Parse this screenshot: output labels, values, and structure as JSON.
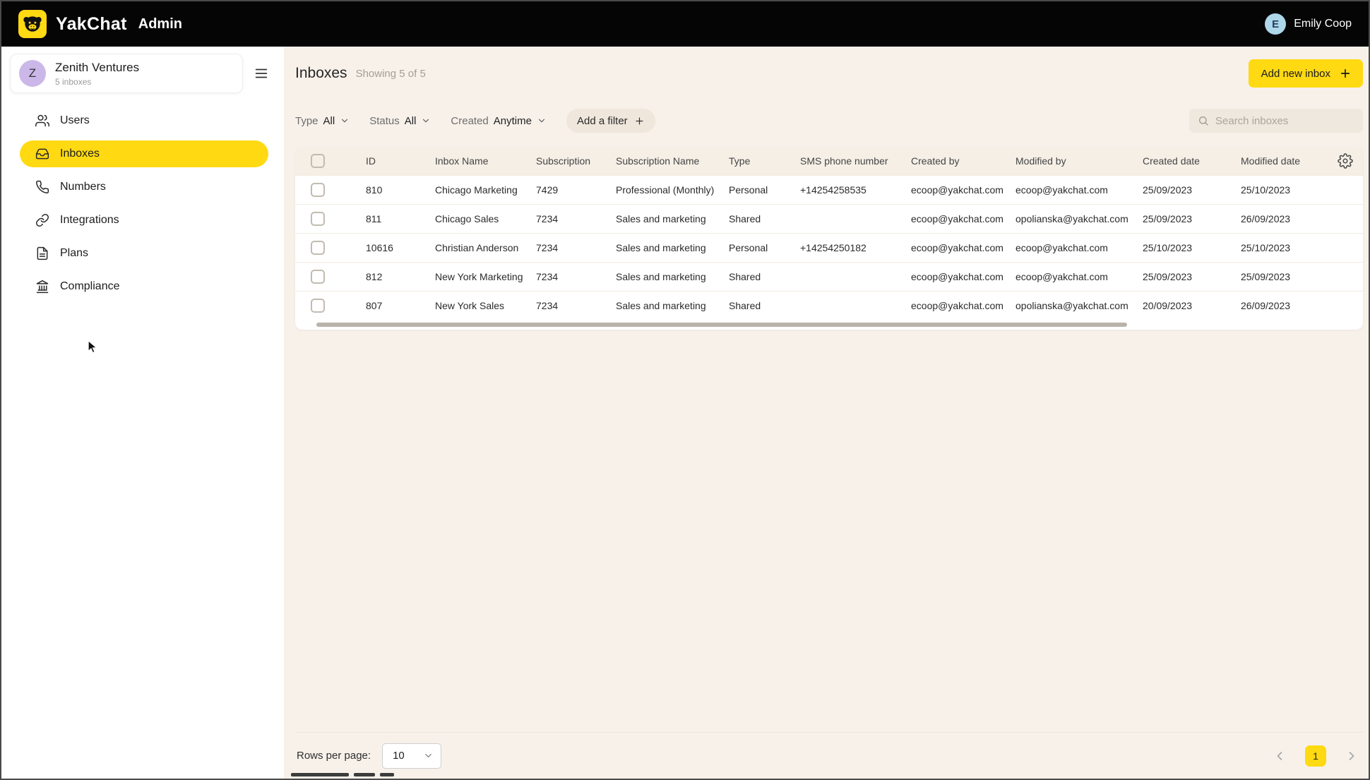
{
  "topbar": {
    "brand": "YakChat",
    "section": "Admin",
    "user": {
      "initial": "E",
      "name": "Emily Coop"
    }
  },
  "sidebar": {
    "org": {
      "initial": "Z",
      "name": "Zenith Ventures",
      "subtitle": "5 inboxes"
    },
    "items": [
      {
        "label": "Users",
        "icon": "users-icon",
        "active": false
      },
      {
        "label": "Inboxes",
        "icon": "inbox-icon",
        "active": true
      },
      {
        "label": "Numbers",
        "icon": "phone-icon",
        "active": false
      },
      {
        "label": "Integrations",
        "icon": "integrations-icon",
        "active": false
      },
      {
        "label": "Plans",
        "icon": "plans-icon",
        "active": false
      },
      {
        "label": "Compliance",
        "icon": "compliance-icon",
        "active": false
      }
    ]
  },
  "page": {
    "title": "Inboxes",
    "subtitle": "Showing 5 of 5",
    "add_button": "Add new inbox"
  },
  "filters": {
    "dropdowns": [
      {
        "label": "Type",
        "value": "All"
      },
      {
        "label": "Status",
        "value": "All"
      },
      {
        "label": "Created",
        "value": "Anytime"
      }
    ],
    "add_filter": "Add a filter",
    "search_placeholder": "Search inboxes"
  },
  "table": {
    "columns": [
      "ID",
      "Inbox Name",
      "Subscription",
      "Subscription Name",
      "Type",
      "SMS phone number",
      "Created by",
      "Modified by",
      "Created date",
      "Modified date"
    ],
    "rows": [
      {
        "id": "810",
        "inbox_name": "Chicago Marketing",
        "subscription": "7429",
        "subscription_name": "Professional (Monthly)",
        "type": "Personal",
        "sms_phone": "+14254258535",
        "created_by": "ecoop@yakchat.com",
        "modified_by": "ecoop@yakchat.com",
        "created_date": "25/09/2023",
        "modified_date": "25/10/2023"
      },
      {
        "id": "811",
        "inbox_name": "Chicago Sales",
        "subscription": "7234",
        "subscription_name": "Sales and marketing",
        "type": "Shared",
        "sms_phone": "",
        "created_by": "ecoop@yakchat.com",
        "modified_by": "opolianska@yakchat.com",
        "created_date": "25/09/2023",
        "modified_date": "26/09/2023"
      },
      {
        "id": "10616",
        "inbox_name": "Christian Anderson",
        "subscription": "7234",
        "subscription_name": "Sales and marketing",
        "type": "Personal",
        "sms_phone": "+14254250182",
        "created_by": "ecoop@yakchat.com",
        "modified_by": "ecoop@yakchat.com",
        "created_date": "25/10/2023",
        "modified_date": "25/10/2023"
      },
      {
        "id": "812",
        "inbox_name": "New York Marketing",
        "subscription": "7234",
        "subscription_name": "Sales and marketing",
        "type": "Shared",
        "sms_phone": "",
        "created_by": "ecoop@yakchat.com",
        "modified_by": "ecoop@yakchat.com",
        "created_date": "25/09/2023",
        "modified_date": "25/09/2023"
      },
      {
        "id": "807",
        "inbox_name": "New York Sales",
        "subscription": "7234",
        "subscription_name": "Sales and marketing",
        "type": "Shared",
        "sms_phone": "",
        "created_by": "ecoop@yakchat.com",
        "modified_by": "opolianska@yakchat.com",
        "created_date": "20/09/2023",
        "modified_date": "26/09/2023"
      }
    ]
  },
  "pagination": {
    "rows_per_page_label": "Rows per page:",
    "rows_per_page_value": "10",
    "current_page": "1"
  },
  "colors": {
    "accent_yellow": "#ffd912",
    "topbar_black": "#050505",
    "content_cream": "#f7f1ea",
    "org_avatar_purple": "#cbb8e8",
    "user_avatar_blue": "#aed7ea"
  }
}
